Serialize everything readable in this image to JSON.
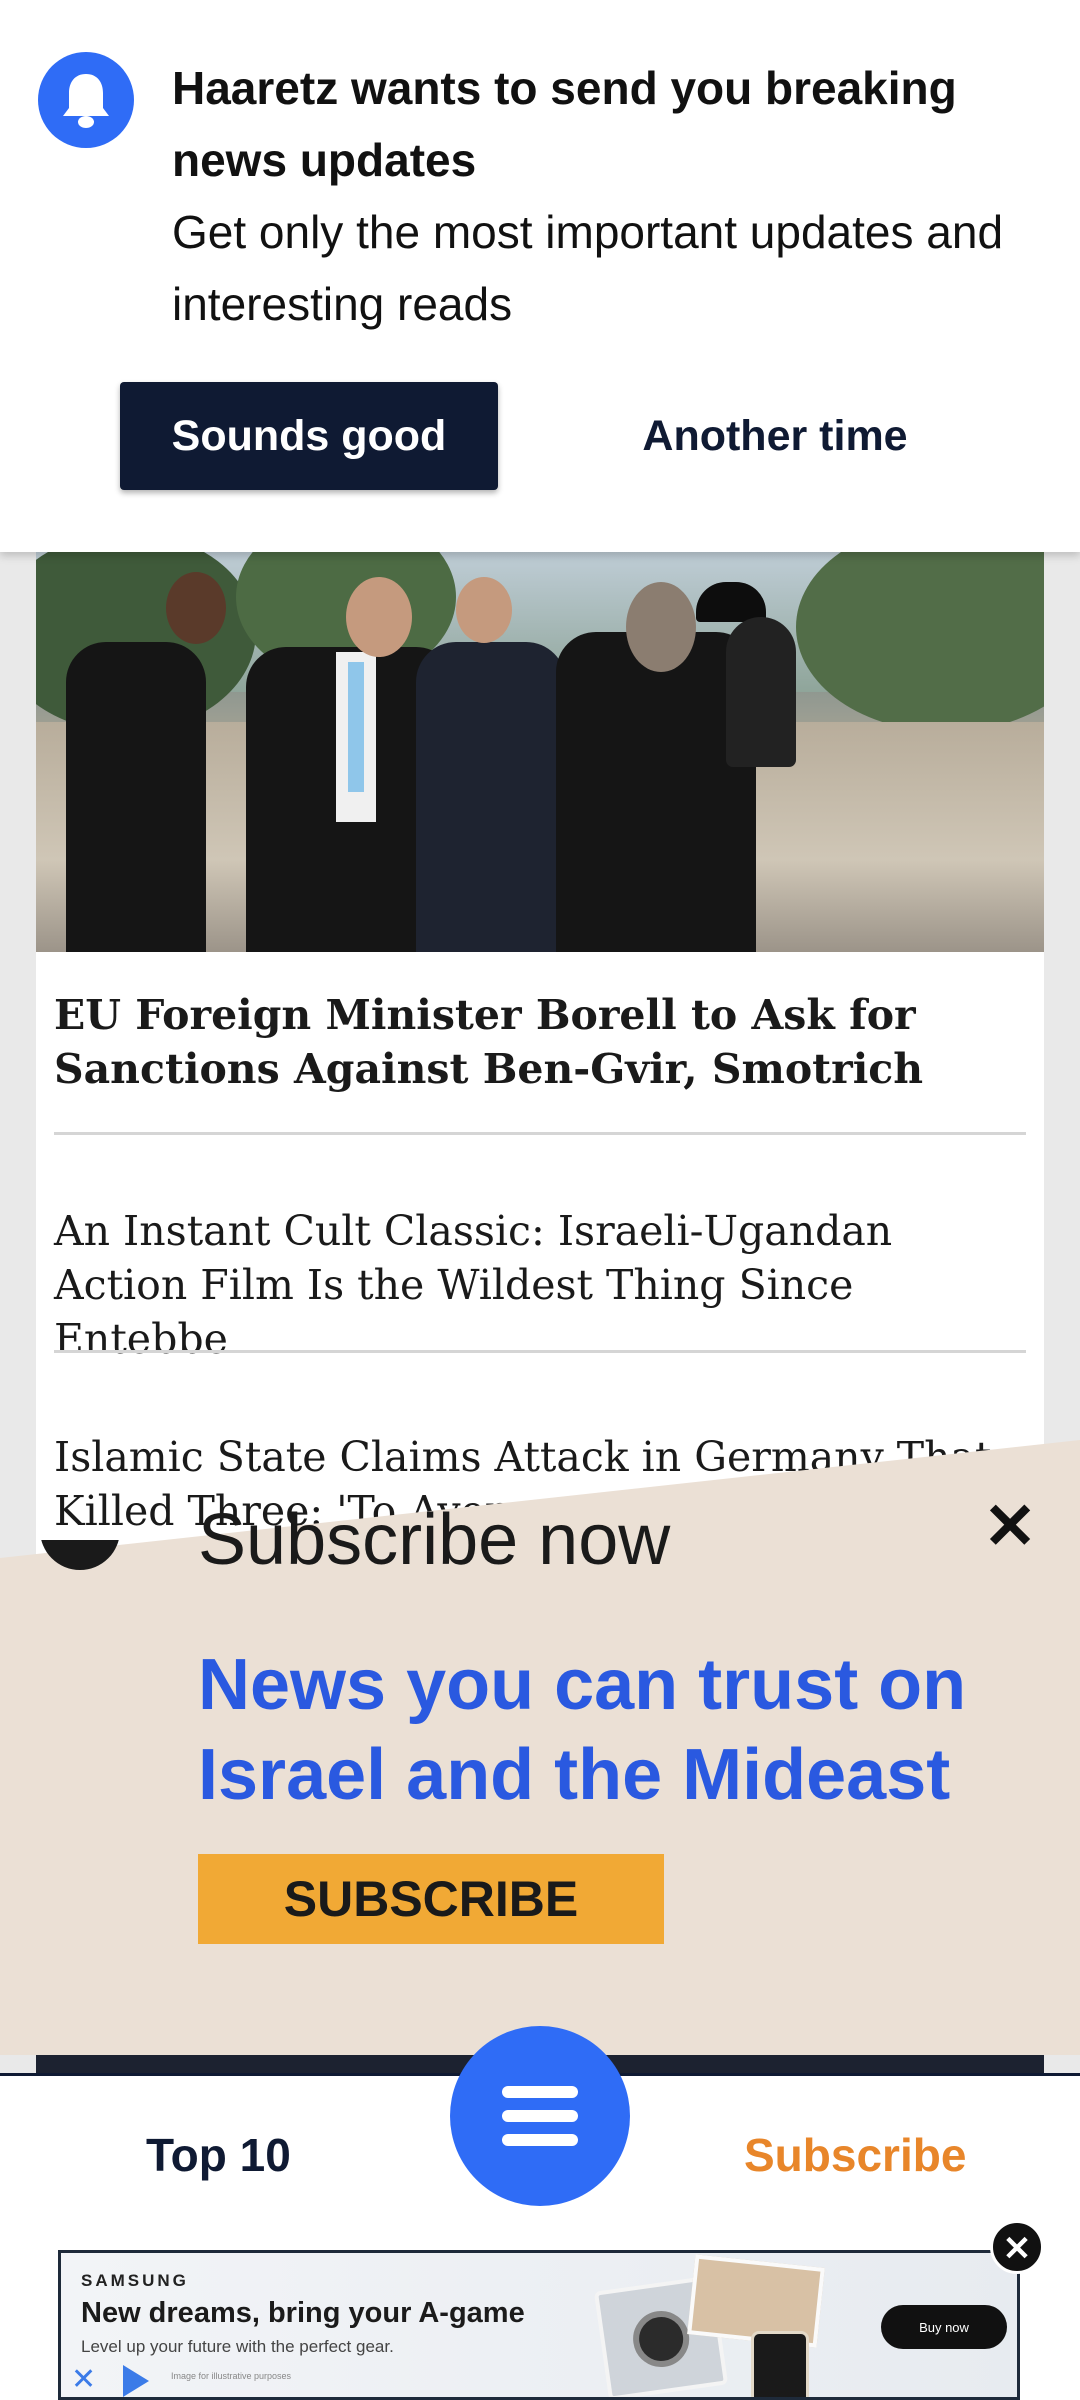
{
  "notification": {
    "title": "Haaretz wants to send you breaking news updates",
    "body": "Get only the most important updates and interesting reads",
    "accept_label": "Sounds good",
    "decline_label": "Another time",
    "icon": "bell-icon"
  },
  "articles": [
    {
      "headline": "EU Foreign Minister Borell to Ask for Sanctions Against Ben-Gvir, Smotrich"
    },
    {
      "headline": "An Instant Cult Classic: Israeli-Ugandan Action Film Is the Wildest Thing Since Entebbe"
    },
    {
      "headline": "Islamic State Claims Attack in Germany That Killed Three: 'To Avenge M"
    }
  ],
  "subscribe_overlay": {
    "title": "Subscribe now",
    "headline": "News you can trust on Israel and the Mideast",
    "button_label": "SUBSCRIBE",
    "close_symbol": "✕"
  },
  "bottom_nav": {
    "top10_label": "Top 10",
    "subscribe_label": "Subscribe",
    "menu_icon": "hamburger-menu-icon"
  },
  "ad": {
    "brand": "SAMSUNG",
    "headline": "New dreams, bring your A-game",
    "subline": "Level up your future with the perfect gear.",
    "fine_print": "Image for illustrative purposes",
    "cta_label": "Buy now",
    "close_symbol": "✕"
  },
  "colors": {
    "brand_blue": "#2f6cf6",
    "navy": "#0f1a33",
    "subscribe_orange": "#e8862a",
    "subscribe_button": "#f1a935",
    "overlay_bg": "#ebe0d5",
    "overlay_headline": "#2a59e0"
  }
}
